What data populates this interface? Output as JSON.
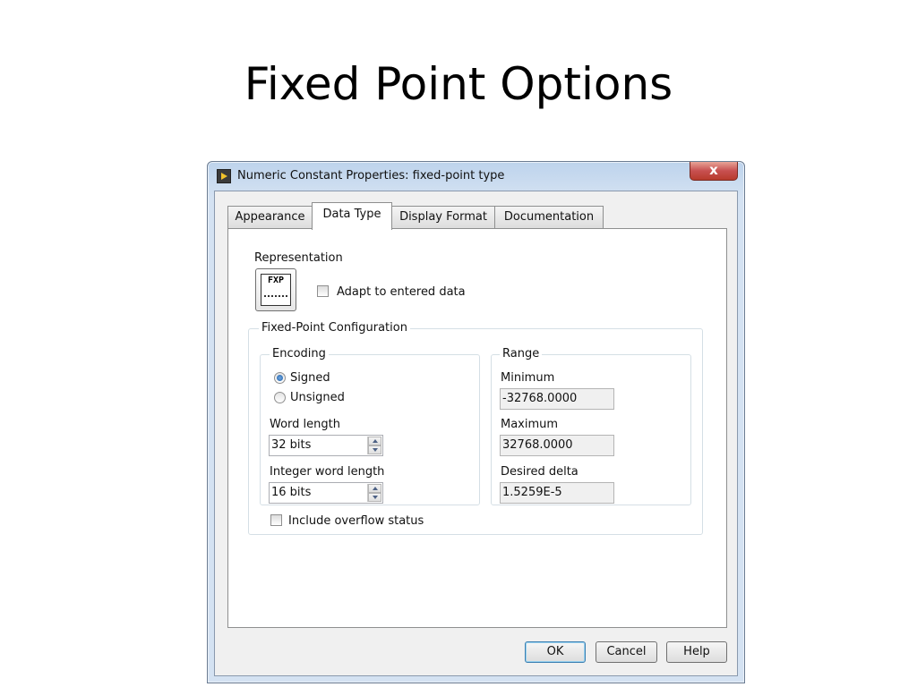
{
  "slide": {
    "title": "Fixed Point Options"
  },
  "window": {
    "title": "Numeric Constant Properties: fixed-point type",
    "title_icon": "labview-constant-icon",
    "close_glyph": "x"
  },
  "tabs": [
    {
      "label": "Appearance",
      "active": false
    },
    {
      "label": "Data Type",
      "active": true
    },
    {
      "label": "Display Format",
      "active": false
    },
    {
      "label": "Documentation",
      "active": false
    }
  ],
  "representation": {
    "label": "Representation",
    "icon_text": "FXP",
    "adapt_label": "Adapt to entered data",
    "adapt_checked": false
  },
  "fixed_point": {
    "legend": "Fixed-Point Configuration",
    "encoding": {
      "legend": "Encoding",
      "signed_label": "Signed",
      "unsigned_label": "Unsigned",
      "selected": "Signed",
      "word_length_label": "Word length",
      "word_length_value": "32 bits",
      "integer_word_length_label": "Integer word length",
      "integer_word_length_value": "16 bits"
    },
    "range": {
      "legend": "Range",
      "minimum_label": "Minimum",
      "minimum_value": "-32768.0000",
      "maximum_label": "Maximum",
      "maximum_value": "32768.0000",
      "delta_label": "Desired delta",
      "delta_value": "1.5259E-5"
    },
    "overflow_label": "Include overflow status",
    "overflow_checked": false
  },
  "buttons": {
    "ok": "OK",
    "cancel": "Cancel",
    "help": "Help"
  },
  "colors": {
    "title_bar": "#c9dcf0",
    "close_button": "#c75050",
    "panel": "#ffffff",
    "dialog_bg": "#f0f0f0"
  }
}
